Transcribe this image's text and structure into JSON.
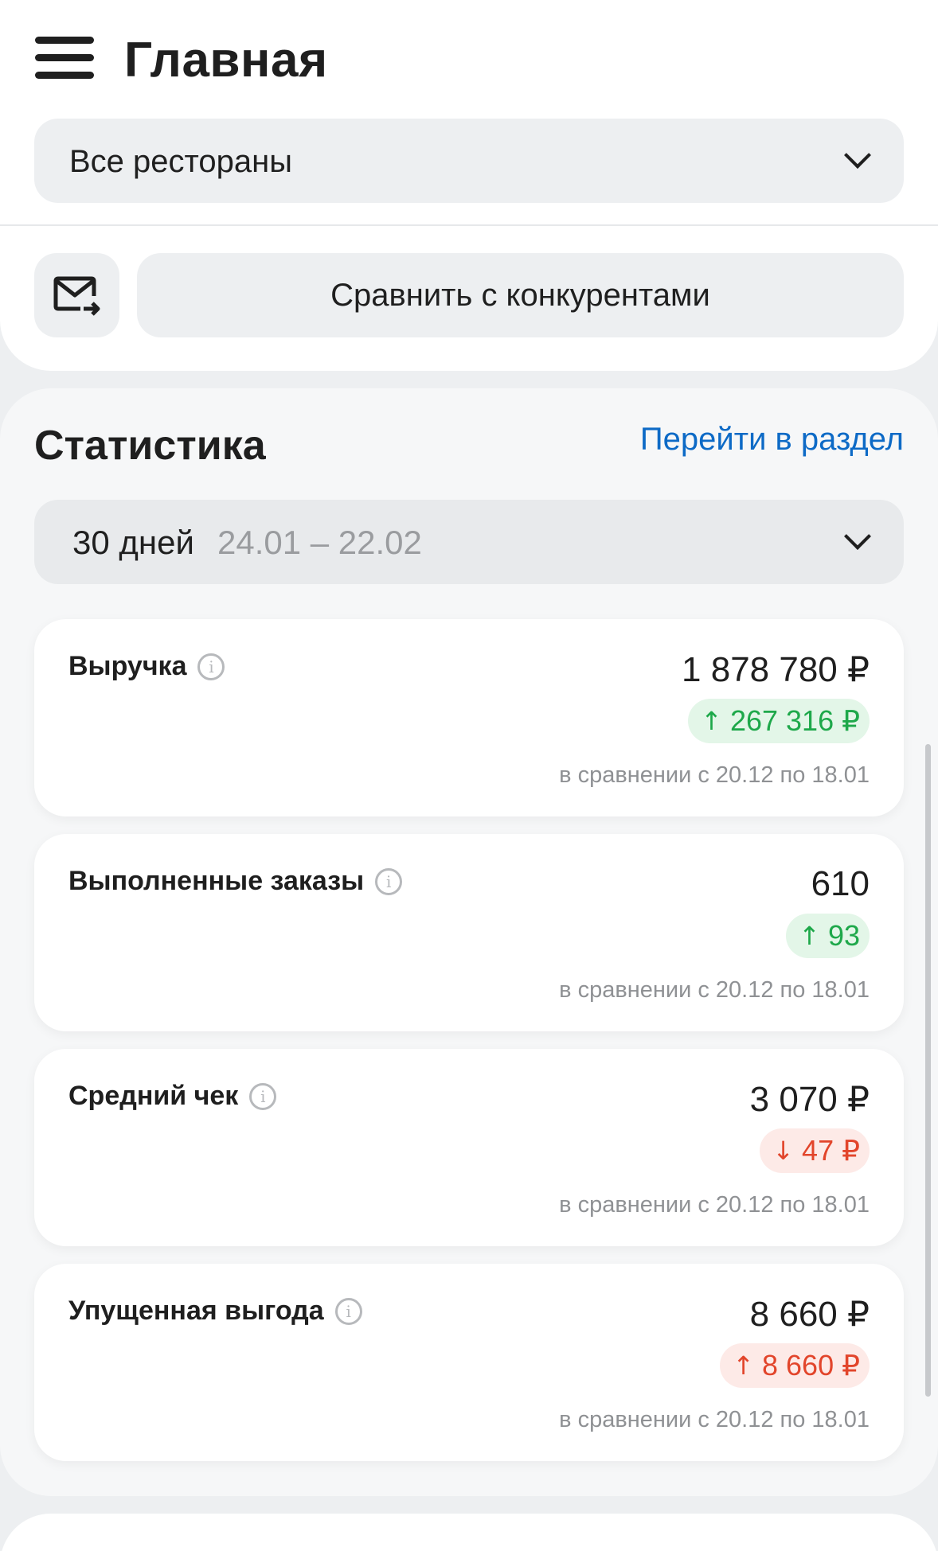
{
  "header": {
    "title": "Главная",
    "restaurant_select": {
      "value": "Все рестораны"
    },
    "compare_button": {
      "label": "Сравнить с конкурентами",
      "icon": "mail-arrow-icon"
    },
    "menu_icon": "hamburger-menu-icon"
  },
  "statistics": {
    "title": "Статистика",
    "link_label": "Перейти в раздел",
    "period": {
      "label": "30 дней",
      "range": "24.01 – 22.02"
    },
    "cards": [
      {
        "label": "Выручка",
        "value": "1 878 780 ₽",
        "delta": "267 316 ₽",
        "delta_direction": "up",
        "delta_tone": "positive",
        "compare_text": "в сравнении с 20.12 по 18.01"
      },
      {
        "label": "Выполненные заказы",
        "value": "610",
        "delta": "93",
        "delta_direction": "up",
        "delta_tone": "positive",
        "compare_text": "в сравнении с 20.12 по 18.01"
      },
      {
        "label": "Средний чек",
        "value": "3 070 ₽",
        "delta": "47 ₽",
        "delta_direction": "down",
        "delta_tone": "negative",
        "compare_text": "в сравнении с 20.12 по 18.01"
      },
      {
        "label": "Упущенная выгода",
        "value": "8 660 ₽",
        "delta": "8 660 ₽",
        "delta_direction": "up",
        "delta_tone": "negative",
        "compare_text": "в сравнении с 20.12 по 18.01"
      }
    ]
  },
  "colors": {
    "link": "#0d6ac6",
    "positive": "#1ea84a",
    "positive_bg": "#e3f6e8",
    "negative": "#e2452b",
    "negative_bg": "#fdeae7",
    "muted_text": "#8f9194",
    "surface": "#edeff1"
  }
}
